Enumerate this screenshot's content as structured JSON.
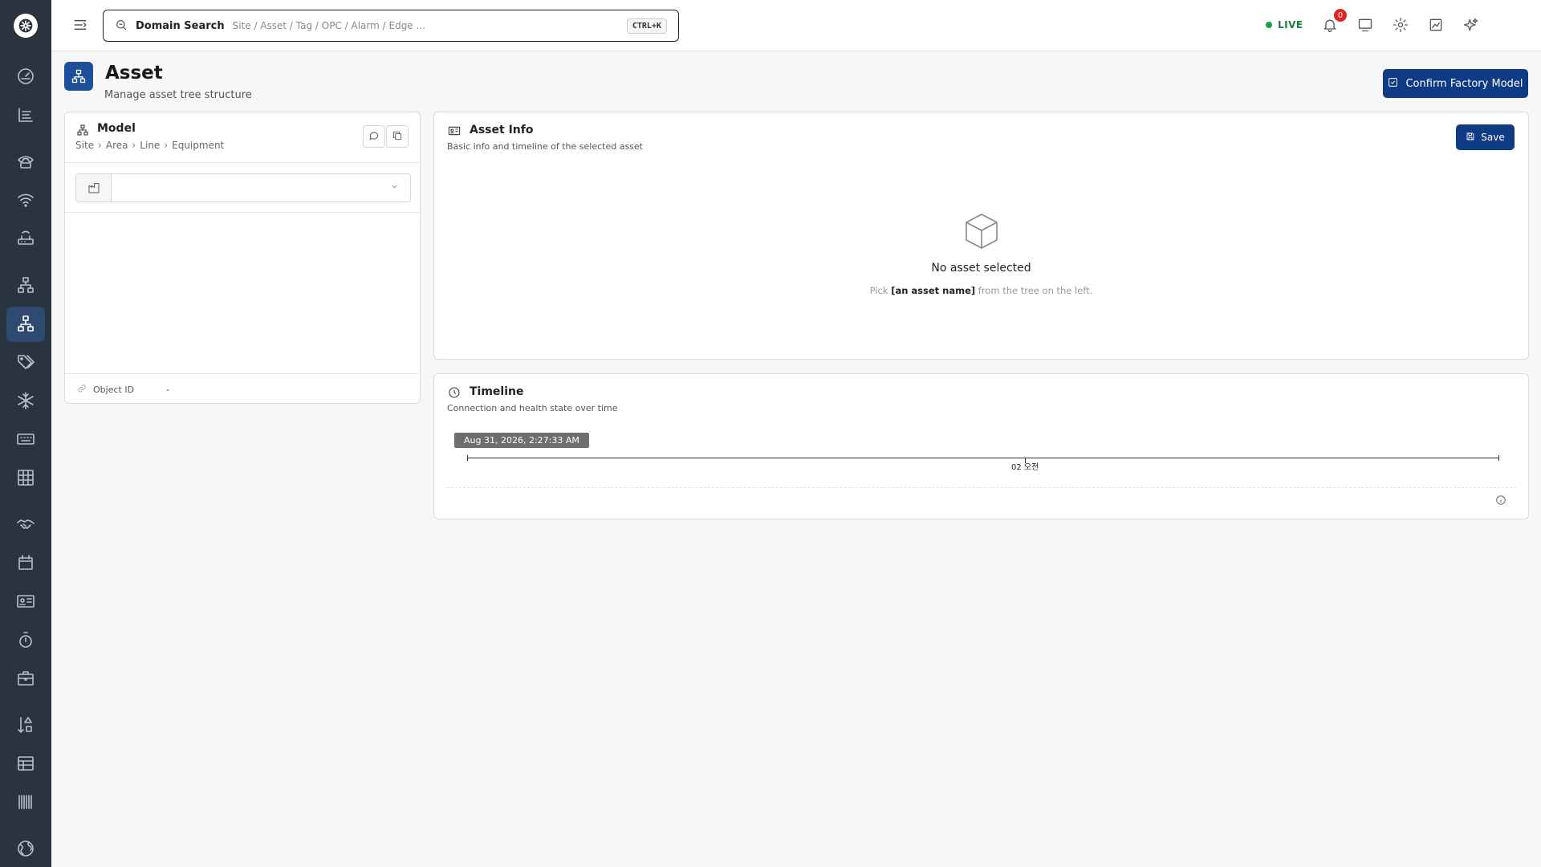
{
  "topbar": {
    "search_label": "Domain Search",
    "search_placeholder": "Site / Asset / Tag / OPC / Alarm / Edge ...",
    "shortcut": "CTRL+K",
    "live_label": "LIVE",
    "notification_count": "0"
  },
  "page": {
    "title": "Asset",
    "subtitle": "Manage asset tree structure",
    "confirm_label": "Confirm Factory Model"
  },
  "model": {
    "title": "Model",
    "breadcrumb": [
      "Site",
      "Area",
      "Line",
      "Equipment"
    ],
    "object_id_label": "Object ID",
    "object_id_value": "-"
  },
  "asset_info": {
    "title": "Asset Info",
    "subtitle": "Basic info and timeline of the selected asset",
    "save_label": "Save",
    "empty_title": "No asset selected",
    "empty_hint_pre": "Pick",
    "empty_hint_bold": "[an asset name]",
    "empty_hint_post": "from the tree on the left."
  },
  "timeline": {
    "title": "Timeline",
    "subtitle": "Connection and health state over time",
    "current_time": "Aug 31, 2026, 2:27:33 AM",
    "axis_label": "02 오전"
  },
  "colors": {
    "sidebar_bg": "#2a3441",
    "primary": "#0f3b84",
    "live_green": "#18a04a",
    "badge_red": "#e02424"
  },
  "sidebar_icons": [
    "logo-icon",
    "dashboard-icon",
    "list-icon",
    "phone-icon",
    "wifi-icon",
    "router-icon",
    "hierarchy-icon",
    "asset-icon",
    "tag-icon",
    "snowflake-icon",
    "keyboard-icon",
    "grid-icon",
    "handshake-icon",
    "calendar-icon",
    "id-card-icon",
    "timer-icon",
    "briefcase-icon",
    "sort-shapes-icon",
    "table-icon",
    "barcode-icon",
    "globe-icon"
  ]
}
